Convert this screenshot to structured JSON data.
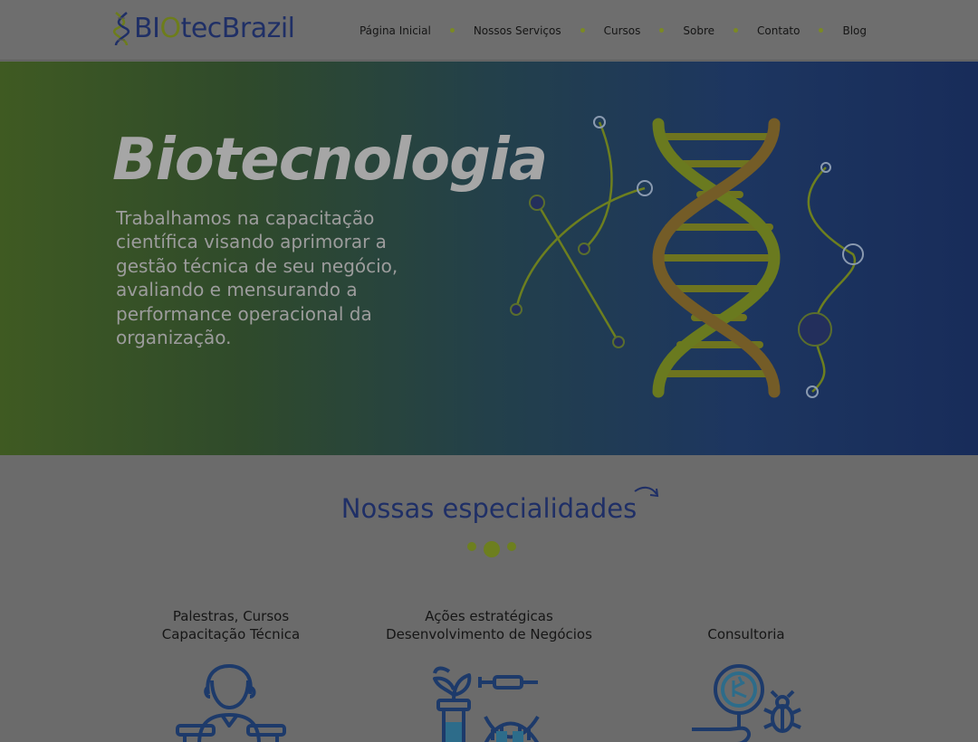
{
  "header": {
    "logo": {
      "part1": "BI",
      "part2": "O",
      "part3": "tecBrazil"
    },
    "nav": [
      {
        "label": "Página Inicial"
      },
      {
        "label": "Nossos Serviços"
      },
      {
        "label": "Cursos"
      },
      {
        "label": "Sobre"
      },
      {
        "label": "Contato"
      },
      {
        "label": "Blog"
      }
    ]
  },
  "hero": {
    "title": "Biotecnologia",
    "text": "Trabalhamos na capacitação científica visando aprimorar a gestão técnica de seu negócio, avaliando e mensurando a performance operacional da organização."
  },
  "specialties": {
    "title": "Nossas especialidades",
    "cards": [
      {
        "line1": "Palestras, Cursos",
        "line2": "Capacitação Técnica",
        "icon": "lecturer-icon"
      },
      {
        "line1": "Ações estratégicas",
        "line2": "Desenvolvimento de Negócios",
        "icon": "lab-plant-dna-icon"
      },
      {
        "line1": "Consultoria",
        "line2": "",
        "icon": "magnifier-bug-icon"
      }
    ]
  },
  "colors": {
    "brand_blue": "#1f2f66",
    "brand_green": "#7b8a23",
    "overlay_gray": "#6b6b6b"
  }
}
